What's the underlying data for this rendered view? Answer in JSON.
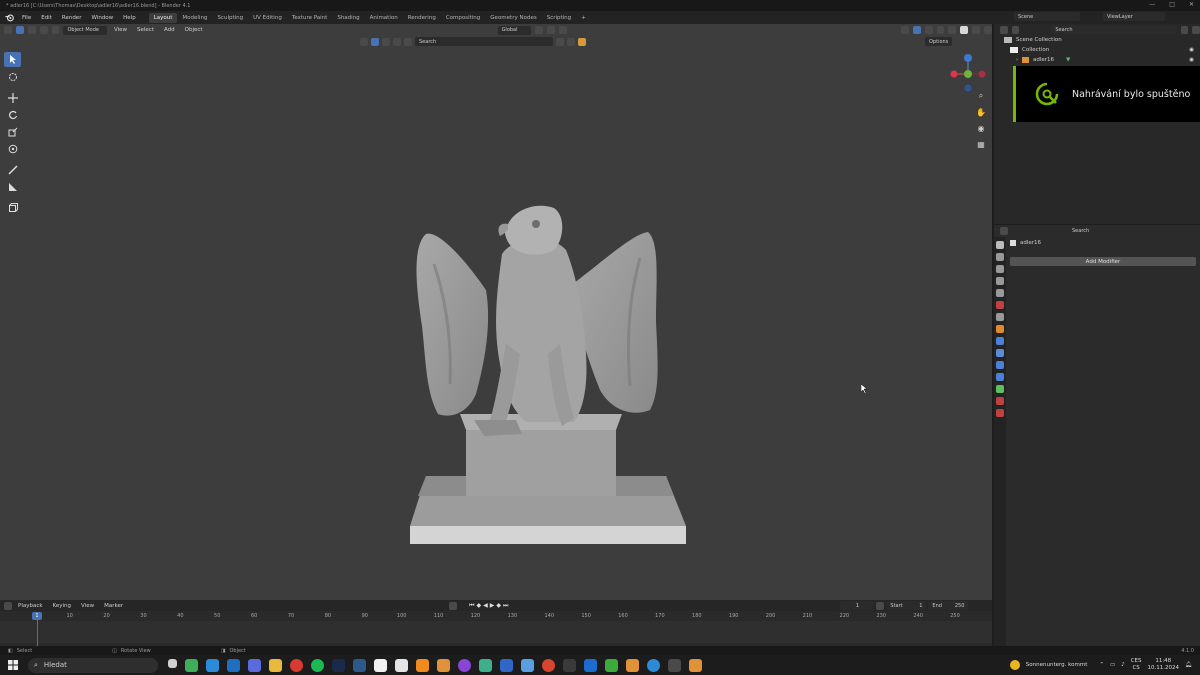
{
  "window": {
    "title": "* adler16 [C:\\Users\\Thomas\\Desktop\\adler16\\adler16.blend] - Blender 4.1",
    "controls": [
      "—",
      "□",
      "✕"
    ]
  },
  "menubar": {
    "menus": [
      "File",
      "Edit",
      "Render",
      "Window",
      "Help"
    ],
    "workspaces": [
      "Layout",
      "Modeling",
      "Sculpting",
      "UV Editing",
      "Texture Paint",
      "Shading",
      "Animation",
      "Rendering",
      "Compositing",
      "Geometry Nodes",
      "Scripting"
    ],
    "active_workspace": "Layout",
    "add_tab": "+",
    "scene_label": "Scene",
    "view_layer_label": "ViewLayer"
  },
  "viewport": {
    "mode": "Object Mode",
    "menus": [
      "View",
      "Select",
      "Add",
      "Object"
    ],
    "orientation": "Global",
    "search_placeholder": "Search",
    "options_label": "Options"
  },
  "outliner": {
    "search_placeholder": "Search",
    "rows": [
      {
        "label": "Scene Collection"
      },
      {
        "label": "Collection"
      },
      {
        "label": "adler16"
      }
    ]
  },
  "notification": {
    "text": "Nahrávání bylo spuštěno"
  },
  "properties": {
    "search_placeholder": "Search",
    "object_name": "adler16",
    "add_modifier_label": "Add Modifier"
  },
  "timeline": {
    "menus": [
      "Playback",
      "Keying",
      "View",
      "Marker"
    ],
    "current_frame": "1",
    "start_label": "Start",
    "start_value": "1",
    "end_label": "End",
    "end_value": "250",
    "ticks": [
      "10",
      "20",
      "30",
      "40",
      "50",
      "60",
      "70",
      "80",
      "90",
      "100",
      "110",
      "120",
      "130",
      "140",
      "150",
      "160",
      "170",
      "180",
      "190",
      "200",
      "210",
      "220",
      "230",
      "240",
      "250"
    ],
    "playhead_frame": "1"
  },
  "statusbar": {
    "select": "Select",
    "rotate": "Rotate View",
    "object": "Object",
    "version": "4.1.0"
  },
  "taskbar": {
    "search_placeholder": "Hledat",
    "weather": "Sonnenunterg. kommt",
    "lang_top": "CES",
    "lang_bottom": "CS",
    "time": "11:48",
    "date": "10.11.2024"
  },
  "colors": {
    "accent_blue": "#4772b3",
    "viewport_bg": "#3d3d3d",
    "nvidia_green": "#76b900"
  }
}
